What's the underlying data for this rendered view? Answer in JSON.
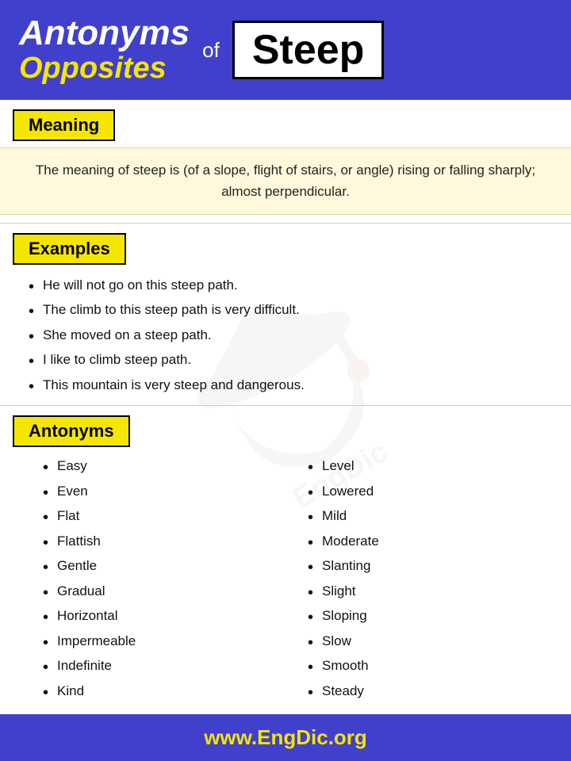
{
  "header": {
    "title_main": "Antonyms",
    "title_sub": "Opposites",
    "of_text": "of",
    "word": "Steep"
  },
  "meaning": {
    "label": "Meaning",
    "text": "The meaning of steep is (of a slope, flight of stairs, or angle) rising or falling sharply; almost perpendicular."
  },
  "examples": {
    "label": "Examples",
    "items": [
      "He will not go on this steep path.",
      "The climb to this steep path is very difficult.",
      "She moved on a steep path.",
      "I like to climb steep path.",
      "This mountain is very steep and dangerous."
    ]
  },
  "antonyms": {
    "label": "Antonyms",
    "col1": [
      "Easy",
      "Even",
      "Flat",
      "Flattish",
      "Gentle",
      "Gradual",
      "Horizontal",
      "Impermeable",
      "Indefinite",
      "Kind"
    ],
    "col2": [
      "Level",
      "Lowered",
      "Mild",
      "Moderate",
      "Slanting",
      "Slight",
      "Sloping",
      "Slow",
      "Smooth",
      "Steady"
    ]
  },
  "footer": {
    "url_prefix": "www.",
    "url_brand": "EngDic",
    "url_suffix": ".org"
  }
}
